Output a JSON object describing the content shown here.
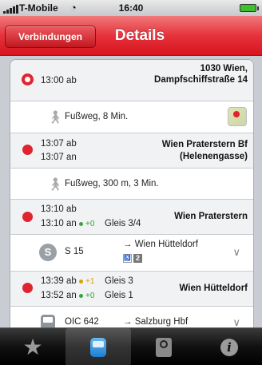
{
  "statusbar": {
    "carrier": "T-Mobile",
    "time": "16:40"
  },
  "navbar": {
    "back_label": "Verbindungen",
    "title": "Details"
  },
  "stops": [
    {
      "time1": "13:00 ab",
      "time2": "",
      "name": "1030 Wien, Dampfschiffstraße 14",
      "gleis1": "",
      "gleis2": "",
      "delay1": "",
      "delay2": ""
    },
    {
      "time1": "13:07 ab",
      "time2": "13:07 an",
      "name": "Wien Praterstern Bf (Helenengasse)",
      "gleis1": "",
      "gleis2": "",
      "delay1": "",
      "delay2": ""
    },
    {
      "time1": "13:10 ab",
      "time2": "13:10 an",
      "name": "Wien Praterstern",
      "gleis1": "",
      "gleis2": "Gleis 3/4",
      "delay1": "",
      "delay2": "+0"
    },
    {
      "time1": "13:39 ab",
      "time2": "13:52 an",
      "name": "Wien Hütteldorf",
      "gleis1": "Gleis 3",
      "gleis2": "Gleis 1",
      "delay1": "+1",
      "delay2": "+0"
    }
  ],
  "legs": [
    {
      "icon": "walk-icon",
      "text": "Fußweg, 8 Min.",
      "direction": "",
      "map": true
    },
    {
      "icon": "walk-icon",
      "text": "Fußweg, 300 m, 3 Min.",
      "direction": "",
      "map": false
    },
    {
      "icon": "s-bahn-icon",
      "text": "S 15",
      "direction": "→ Wien Hütteldorf",
      "badge": "2"
    },
    {
      "icon": "train-icon",
      "text": "OIC 642",
      "direction": "→ Salzburg Hbf"
    }
  ],
  "colors": {
    "accent": "#e0242f",
    "on_time": "#3aa33a",
    "delayed": "#d9a300"
  },
  "tabs": [
    {
      "icon": "star-icon",
      "active": false
    },
    {
      "icon": "train-icon",
      "active": true
    },
    {
      "icon": "ticket-clock-icon",
      "active": false
    },
    {
      "icon": "info-icon",
      "active": false
    }
  ]
}
